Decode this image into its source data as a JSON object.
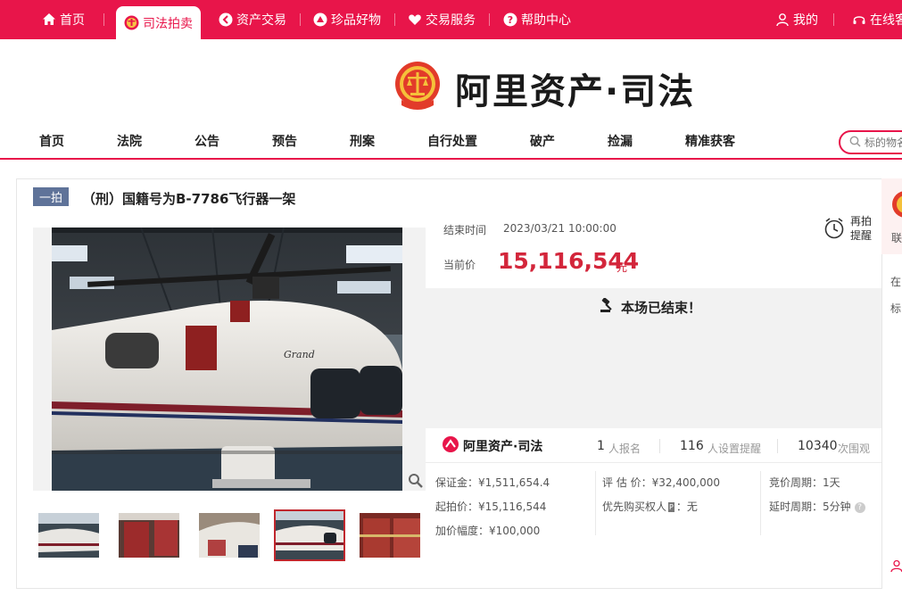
{
  "topnav": {
    "items": [
      {
        "label": "首页",
        "icon": "home-icon"
      },
      {
        "label": "司法拍卖",
        "icon": "court-emblem-icon",
        "active": true
      },
      {
        "label": "资产交易",
        "icon": "asset-icon"
      },
      {
        "label": "珍品好物",
        "icon": "treasure-icon"
      },
      {
        "label": "交易服务",
        "icon": "heart-icon"
      },
      {
        "label": "帮助中心",
        "icon": "help-icon"
      }
    ],
    "mine": "我的",
    "online": "在线客"
  },
  "brand": {
    "text": "阿里资产·司法",
    "emblem": "court-emblem-logo"
  },
  "mainnav": {
    "items": [
      "首页",
      "法院",
      "公告",
      "预告",
      "刑案",
      "自行处置",
      "破产",
      "捡漏",
      "精准获客"
    ]
  },
  "search": {
    "placeholder": "标的物名"
  },
  "item": {
    "badge": "一拍",
    "title": "（刑）国籍号为B-7786飞行器一架",
    "end_label": "结束时间",
    "end_time": "2023/03/21 10:00:00",
    "price_label": "当前价",
    "price": "15,116,544",
    "price_unit": "元",
    "remind": "再拍\n提醒",
    "ended_text": "本场已结束！",
    "brand_small": "阿里资产·司法",
    "stats": [
      {
        "num": "1",
        "unit": "人报名"
      },
      {
        "num": "116",
        "unit": "人设置提醒"
      },
      {
        "num": "10340",
        "unit": "次围观"
      }
    ],
    "details": {
      "deposit": "保证金：¥1,511,654.4",
      "start_price": "起拍价：¥15,116,544",
      "increment": "加价幅度：¥100,000",
      "appraisal": "评 估 价：¥32,400,000",
      "priority_label": "优先购买权人",
      "priority_tag": "P",
      "priority_value": "：无",
      "cycle": "竞价周期：1天",
      "delay": "延时周期：5分钟"
    }
  },
  "sidebar": {
    "lines": [
      "联",
      "在",
      "标"
    ]
  },
  "colors": {
    "brand_red": "#e8154a",
    "price_red": "#d3263b",
    "badge_blue": "#5f7399"
  }
}
